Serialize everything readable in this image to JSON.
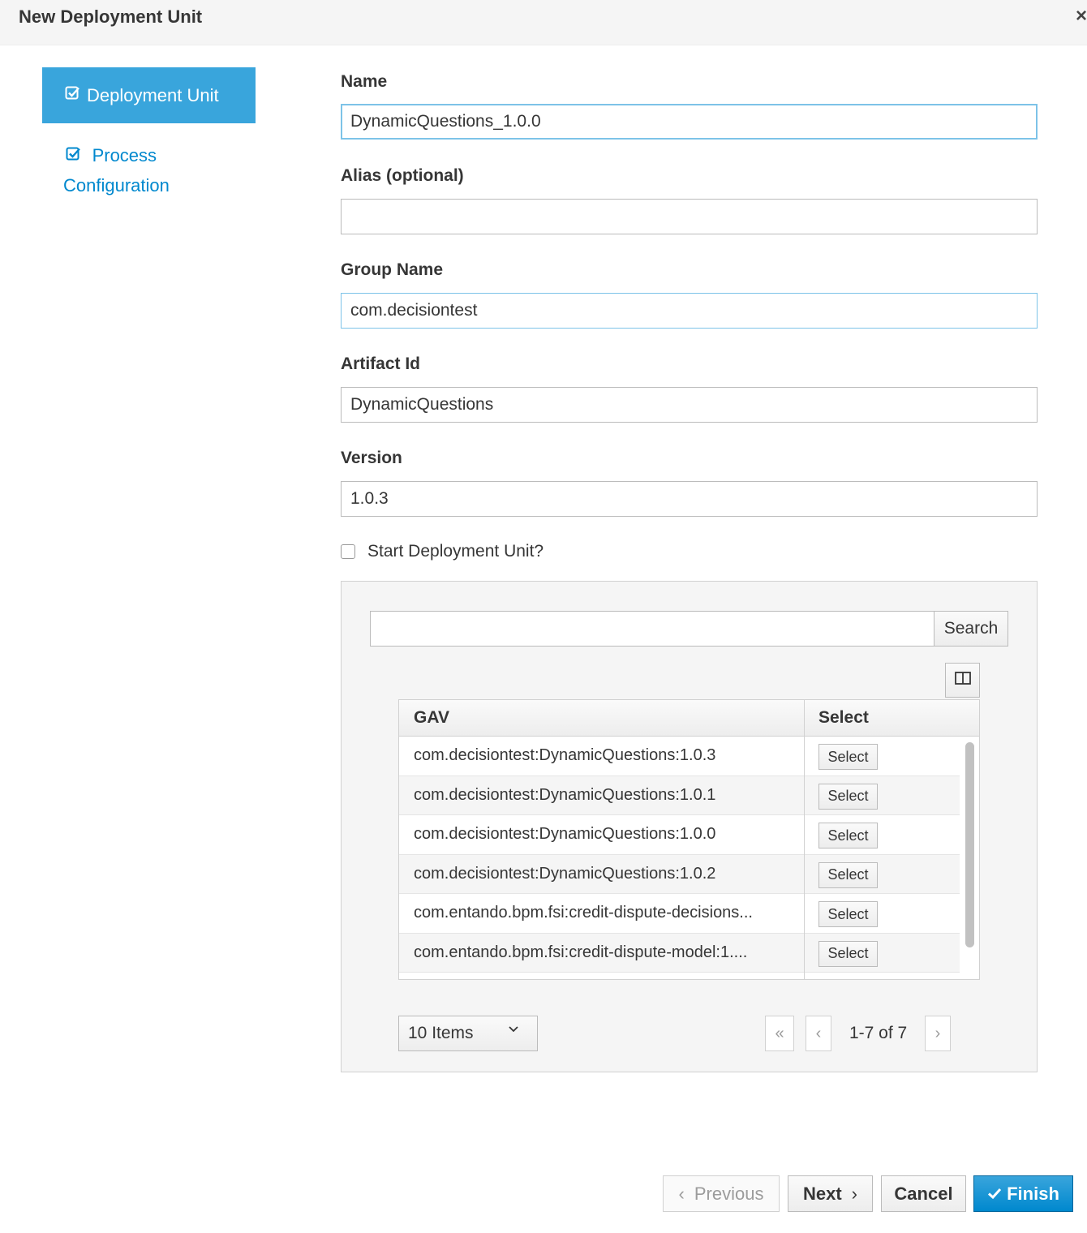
{
  "modal": {
    "title": "New Deployment Unit",
    "close_label": "×"
  },
  "wizard": {
    "steps": [
      {
        "label": "Deployment Unit",
        "icon": "check-square-icon",
        "active": true
      },
      {
        "label": "Process Configuration",
        "icon": "check-square-icon",
        "active": false
      }
    ]
  },
  "form": {
    "name_label": "Name",
    "name_value": "DynamicQuestions_1.0.0",
    "alias_label": "Alias (optional)",
    "alias_value": "",
    "group_label": "Group Name",
    "group_value": "com.decisiontest",
    "artifact_label": "Artifact Id",
    "artifact_value": "DynamicQuestions",
    "version_label": "Version",
    "version_value": "1.0.3",
    "start_label": "Start Deployment Unit?",
    "start_checked": false
  },
  "artifacts": {
    "search_value": "",
    "search_button": "Search",
    "columns": [
      "GAV",
      "Select"
    ],
    "rows": [
      {
        "gav": "com.decisiontest:DynamicQuestions:1.0.3",
        "action": "Select"
      },
      {
        "gav": "com.decisiontest:DynamicQuestions:1.0.1",
        "action": "Select"
      },
      {
        "gav": "com.decisiontest:DynamicQuestions:1.0.0",
        "action": "Select"
      },
      {
        "gav": "com.decisiontest:DynamicQuestions:1.0.2",
        "action": "Select"
      },
      {
        "gav": "com.entando.bpm.fsi:credit-dispute-decisions...",
        "action": "Select"
      },
      {
        "gav": "com.entando.bpm.fsi:credit-dispute-model:1....",
        "action": "Select"
      }
    ],
    "page_size": "10 Items",
    "page_info": "1-7 of 7"
  },
  "footer": {
    "previous": "Previous",
    "next": "Next",
    "cancel": "Cancel",
    "finish": "Finish"
  },
  "colors": {
    "primary": "#39a5dc",
    "link": "#0088ce",
    "focus_border": "#7dc3e8"
  }
}
